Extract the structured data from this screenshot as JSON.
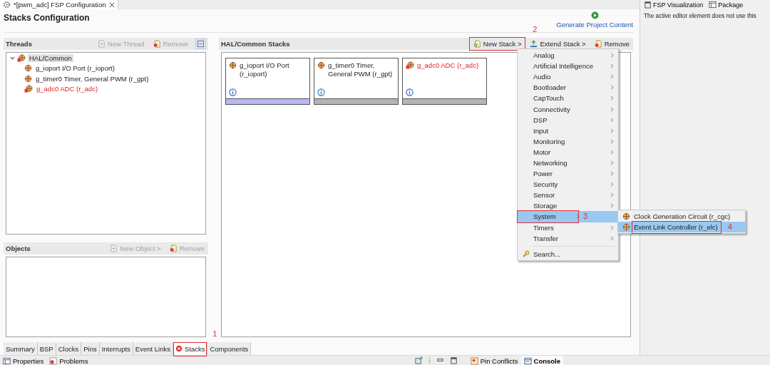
{
  "editor_tab": {
    "title": "*[pwm_adc] FSP Configuration"
  },
  "side_tabs": [
    {
      "label": "FSP Visualization"
    },
    {
      "label": "Package"
    }
  ],
  "side_message": "The active editor element does not use this",
  "page_title": "Stacks Configuration",
  "generate_link": "Generate Project Content",
  "threads": {
    "title": "Threads",
    "actions": [
      {
        "label": "New Thread",
        "disabled": true
      },
      {
        "label": "Remove",
        "disabled": true
      }
    ],
    "tree": [
      {
        "label": "HAL/Common",
        "expanded": true,
        "error": true,
        "selected": true,
        "children": [
          {
            "label": "g_ioport I/O Port (r_ioport)",
            "error": false,
            "selected": false
          },
          {
            "label": "g_timer0 Timer, General PWM (r_gpt)",
            "error": false,
            "selected": false
          },
          {
            "label": "g_adc0 ADC (r_adc)",
            "error": true,
            "selected": false
          }
        ]
      }
    ]
  },
  "objects": {
    "title": "Objects",
    "actions": [
      {
        "label": "New Object >",
        "disabled": true
      },
      {
        "label": "Remove",
        "disabled": true
      }
    ]
  },
  "stacks": {
    "title": "HAL/Common Stacks",
    "actions": [
      {
        "label": "New Stack >",
        "disabled": false,
        "callout": {
          "number": "2"
        }
      },
      {
        "label": "Extend Stack >",
        "disabled": false
      },
      {
        "label": "Remove",
        "disabled": false
      }
    ],
    "cards": [
      {
        "name": "g_ioport I/O Port (r_ioport)",
        "error": false,
        "selected": true
      },
      {
        "name": "g_timer0 Timer, General PWM (r_gpt)",
        "error": false,
        "selected": false
      },
      {
        "name": "g_adc0 ADC (r_adc)",
        "error": true,
        "selected": false
      }
    ]
  },
  "menu": {
    "items": [
      {
        "label": "Analog",
        "kind": "submenu",
        "selected": false
      },
      {
        "label": "Artificial Intelligence",
        "kind": "submenu",
        "selected": false
      },
      {
        "label": "Audio",
        "kind": "submenu",
        "selected": false
      },
      {
        "label": "Bootloader",
        "kind": "submenu",
        "selected": false
      },
      {
        "label": "CapTouch",
        "kind": "submenu",
        "selected": false
      },
      {
        "label": "Connectivity",
        "kind": "submenu",
        "selected": false
      },
      {
        "label": "DSP",
        "kind": "submenu",
        "selected": false
      },
      {
        "label": "Input",
        "kind": "submenu",
        "selected": false
      },
      {
        "label": "Monitoring",
        "kind": "submenu",
        "selected": false
      },
      {
        "label": "Motor",
        "kind": "submenu",
        "selected": false
      },
      {
        "label": "Networking",
        "kind": "submenu",
        "selected": false
      },
      {
        "label": "Power",
        "kind": "submenu",
        "selected": false
      },
      {
        "label": "Security",
        "kind": "submenu",
        "selected": false
      },
      {
        "label": "Sensor",
        "kind": "submenu",
        "selected": false
      },
      {
        "label": "Storage",
        "kind": "submenu",
        "selected": false
      },
      {
        "label": "System",
        "kind": "submenu",
        "selected": true,
        "callout": {
          "number": "3"
        }
      },
      {
        "label": "Timers",
        "kind": "submenu",
        "selected": false
      },
      {
        "label": "Transfer",
        "kind": "submenu",
        "selected": false
      },
      {
        "label": "Search...",
        "kind": "search",
        "selected": false
      }
    ]
  },
  "submenu": {
    "items": [
      {
        "label": "Clock Generation Circuit (r_cgc)",
        "selected": false
      },
      {
        "label": "Event Link Controller (r_elc)",
        "selected": true,
        "callout": {
          "number": "4"
        }
      }
    ]
  },
  "page_tabs": [
    {
      "label": "Summary",
      "selected": false,
      "error": false
    },
    {
      "label": "BSP",
      "selected": false,
      "error": false
    },
    {
      "label": "Clocks",
      "selected": false,
      "error": false
    },
    {
      "label": "Pins",
      "selected": false,
      "error": false
    },
    {
      "label": "Interrupts",
      "selected": false,
      "error": false
    },
    {
      "label": "Event Links",
      "selected": false,
      "error": false
    },
    {
      "label": "Stacks",
      "selected": true,
      "error": true,
      "callout": {
        "number": "1"
      }
    },
    {
      "label": "Components",
      "selected": false,
      "error": false
    }
  ],
  "bottom_views_left": [
    {
      "label": "Properties",
      "selected": false
    },
    {
      "label": "Problems",
      "selected": false
    }
  ],
  "bottom_views_right": [
    {
      "label": "Pin Conflicts",
      "selected": false
    },
    {
      "label": "Console",
      "selected": true
    }
  ]
}
